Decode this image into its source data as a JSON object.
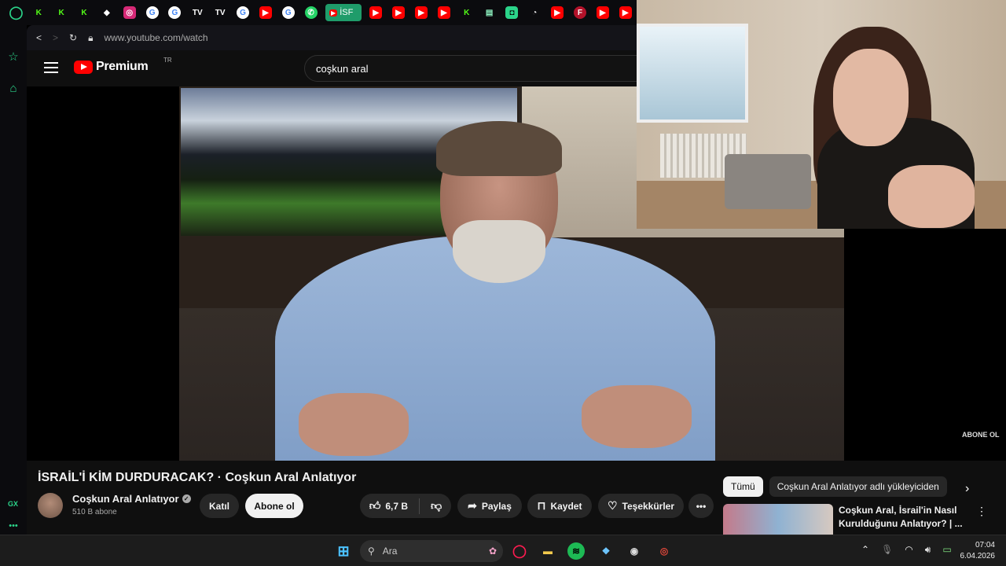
{
  "browser": {
    "active_tab_label": "İSF",
    "url": "www.youtube.com/watch",
    "sidebar_badge": "GX"
  },
  "youtube": {
    "logo_text": "Premium",
    "region": "TR",
    "search_query": "coşkun aral"
  },
  "video": {
    "title": "İSRAİL'İ KİM DURDURACAK? · Coşkun Aral Anlatıyor",
    "channel_name": "Coşkun Aral Anlatıyor",
    "subscribers": "510 B abone",
    "join_label": "Katıl",
    "subscribe_label": "Abone ol",
    "likes": "6,7 B",
    "share_label": "Paylaş",
    "save_label": "Kaydet",
    "thanks_label": "Teşekkürler",
    "watermark": "ABONE OL"
  },
  "recommendations": {
    "chips": [
      "Tümü",
      "Coşkun Aral Anlatıyor adlı yükleyiciden"
    ],
    "items": [
      {
        "title": "Coşkun Aral, İsrail'in Nasıl Kurulduğunu Anlatıyor? | ..."
      }
    ]
  },
  "taskbar": {
    "search_placeholder": "Ara",
    "time": "07:04",
    "date": "6.04.2026"
  },
  "colors": {
    "accent": "#2bd48a",
    "youtube_red": "#ff0000",
    "active_tab": "#1f9c6a"
  }
}
